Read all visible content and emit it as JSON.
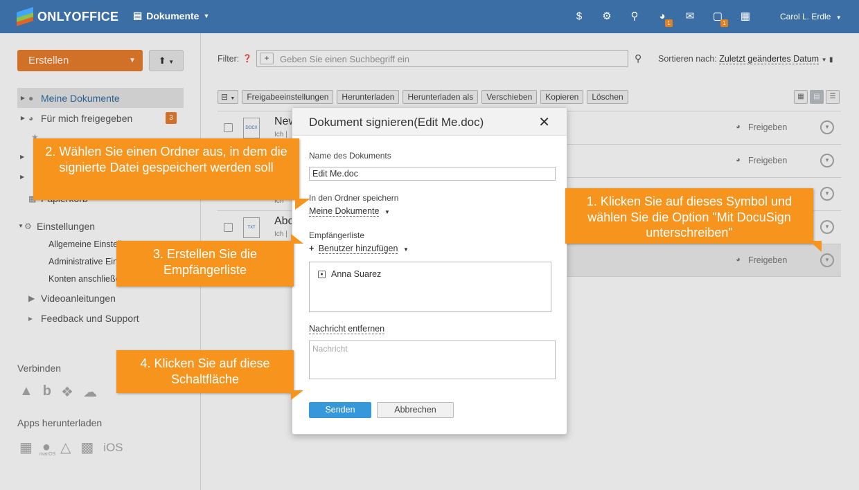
{
  "topbar": {
    "logo_text": "ONLYOFFICE",
    "module": "Dokumente",
    "user_name": "Carol L. Erdle",
    "icons": [
      "dollar-icon",
      "gear-icon",
      "search-icon",
      "feed-icon",
      "mail-icon",
      "chat-icon",
      "calendar-icon"
    ],
    "badges": {
      "feed": "1",
      "chat": "1"
    },
    "colors": {
      "bar": "#3a6ea5",
      "accent": "#e97d2c",
      "primary": "#3498db",
      "callout": "#f7941d"
    }
  },
  "sidebar": {
    "create_label": "Erstellen",
    "tree": [
      {
        "label": "Meine Dokumente",
        "active": true
      },
      {
        "label": "Für mich freigegeben",
        "count": "3"
      }
    ],
    "trash_label": "Papierkorb",
    "settings_label": "Einstellungen",
    "settings_items": [
      "Allgemeine Einstellungen",
      "Administrative Einstellungen",
      "Konten anschließen"
    ],
    "video_label": "Videoanleitungen",
    "feedback_label": "Feedback und Support",
    "connect_title": "Verbinden",
    "apps_title": "Apps herunterladen",
    "macos_label": "macOS",
    "ios_label": "iOS"
  },
  "main": {
    "filter_label": "Filter:",
    "search_placeholder": "Geben Sie einen Suchbegriff ein",
    "sort_label": "Sortieren nach:",
    "sort_value": "Zuletzt geändertes Datum",
    "toolbar": [
      "Freigabeeinstellungen",
      "Herunterladen",
      "Herunterladen als",
      "Verschieben",
      "Kopieren",
      "Löschen"
    ],
    "files": [
      {
        "name": "New",
        "meta": "Ich |",
        "type": "DOCX",
        "share": "Freigeben"
      },
      {
        "name": "",
        "meta": "",
        "type": "",
        "share": "Freigeben"
      },
      {
        "name": "",
        "meta": "Ich",
        "type": "",
        "share": ""
      },
      {
        "name": "Abc",
        "meta": "Ich |",
        "type": "TXT",
        "share": ""
      },
      {
        "name": "",
        "meta": "",
        "type": "",
        "share": "Freigeben"
      }
    ]
  },
  "dialog": {
    "title": "Dokument signieren(Edit Me.doc)",
    "doc_name_label": "Name des Dokuments",
    "doc_name_value": "Edit Me.doc",
    "folder_label": "In den Ordner speichern",
    "folder_value": "Meine Dokumente",
    "recipients_label": "Empfängerliste",
    "add_user_label": "Benutzer hinzufügen",
    "recipients": [
      "Anna Suarez"
    ],
    "remove_message_label": "Nachricht entfernen",
    "message_placeholder": "Nachricht",
    "send_label": "Senden",
    "cancel_label": "Abbrechen"
  },
  "callouts": {
    "c1": "1. Klicken Sie auf dieses Symbol und wählen Sie die Option \"Mit DocuSign unterschreiben\"",
    "c2": "2. Wählen Sie einen Ordner aus, in dem die signierte Datei gespeichert werden soll",
    "c3": "3. Erstellen Sie die Empfängerliste",
    "c4": "4. Klicken Sie auf diese Schaltfläche"
  }
}
